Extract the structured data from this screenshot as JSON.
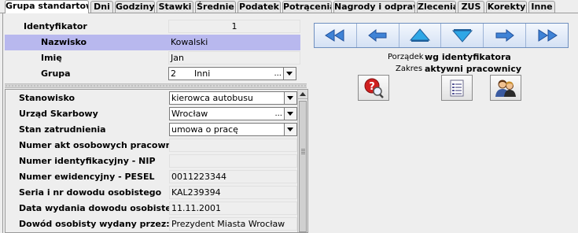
{
  "tabs": [
    {
      "label": "Grupa standartowa",
      "active": true
    },
    {
      "label": "Dni",
      "active": false
    },
    {
      "label": "Godziny",
      "active": false
    },
    {
      "label": "Stawki",
      "active": false
    },
    {
      "label": "Średnie",
      "active": false
    },
    {
      "label": "Podatek",
      "active": false
    },
    {
      "label": "Potrącenia",
      "active": false
    },
    {
      "label": "Nagrody i odprawy",
      "active": false
    },
    {
      "label": "Zlecenia",
      "active": false
    },
    {
      "label": "ZUS",
      "active": false
    },
    {
      "label": "Korekty",
      "active": false
    },
    {
      "label": "Inne",
      "active": false
    }
  ],
  "top_form": {
    "identyfikator": {
      "label": "Identyfikator",
      "value": "1"
    },
    "nazwisko": {
      "label": "Nazwisko",
      "value": "Kowalski"
    },
    "imie": {
      "label": "Imię",
      "value": "Jan"
    },
    "grupa": {
      "label": "Grupa",
      "value": "2",
      "value2": "Inni",
      "dots": "..."
    }
  },
  "details": {
    "stanowisko": {
      "label": "Stanowisko",
      "value": "kierowca autobusu"
    },
    "urzad": {
      "label": "Urząd Skarbowy",
      "value": "Wrocław",
      "dots": "..."
    },
    "stan": {
      "label": "Stan zatrudnienia",
      "value": "umowa o pracę"
    },
    "akt": {
      "label": "Numer akt osobowych pracownika",
      "value": ""
    },
    "nip": {
      "label": "Numer identyfikacyjny - NIP",
      "value": ""
    },
    "pesel": {
      "label": "Numer ewidencyjny - PESEL",
      "value": "0011223344"
    },
    "dowod": {
      "label": "Seria i nr dowodu osobistego",
      "value": "KAL239394"
    },
    "data_wydania": {
      "label": "Data wydania dowodu osobistego",
      "value": "11.11.2001"
    },
    "wydany_przez": {
      "label": "Dowód osobisty wydany przez:",
      "value": "Prezydent Miasta Wrocław"
    }
  },
  "right": {
    "porzadek": {
      "label": "Porządek",
      "value": "wg identyfikatora"
    },
    "zakres": {
      "label": "Zakres",
      "value": "aktywni pracownicy"
    }
  },
  "icons": {
    "nav": [
      "first-icon",
      "previous-icon",
      "up-icon",
      "down-icon",
      "next-icon",
      "last-icon"
    ],
    "actions": [
      "search-help-icon",
      "list-icon",
      "users-icon"
    ]
  }
}
